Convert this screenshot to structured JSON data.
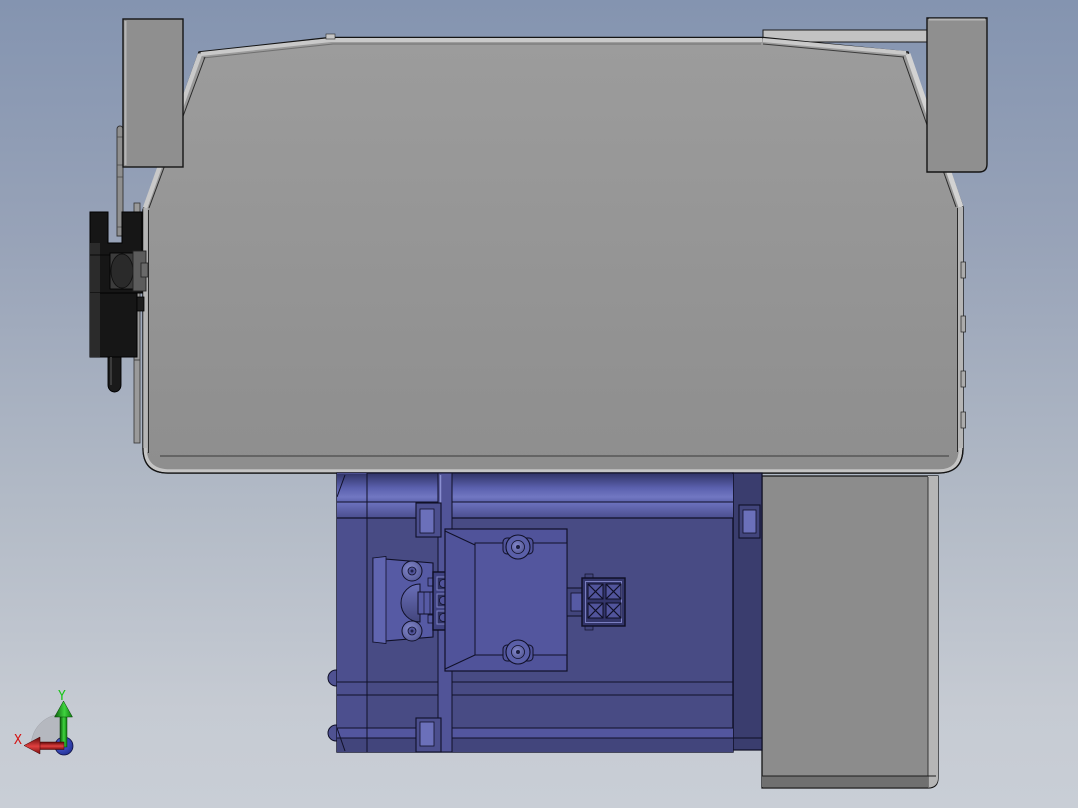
{
  "triad": {
    "x_label": "X",
    "y_label": "Y",
    "x_axis_color": "#d41414",
    "y_axis_color": "#18c518",
    "z_axis_color": "#2a3fd4"
  },
  "colors": {
    "background_top": "#8494b0",
    "background_bottom": "#c9ced6",
    "bracket_gray": "#949494",
    "bracket_edge_highlight": "#c9c9c9",
    "side_panel_gray": "#8c8c8c",
    "motor_body": "#484b84",
    "motor_highlight_band": "#7177c2",
    "motor_dark_strip": "#3a3d6e",
    "connector_dark": "#33356a",
    "hardware_black": "#161616"
  }
}
